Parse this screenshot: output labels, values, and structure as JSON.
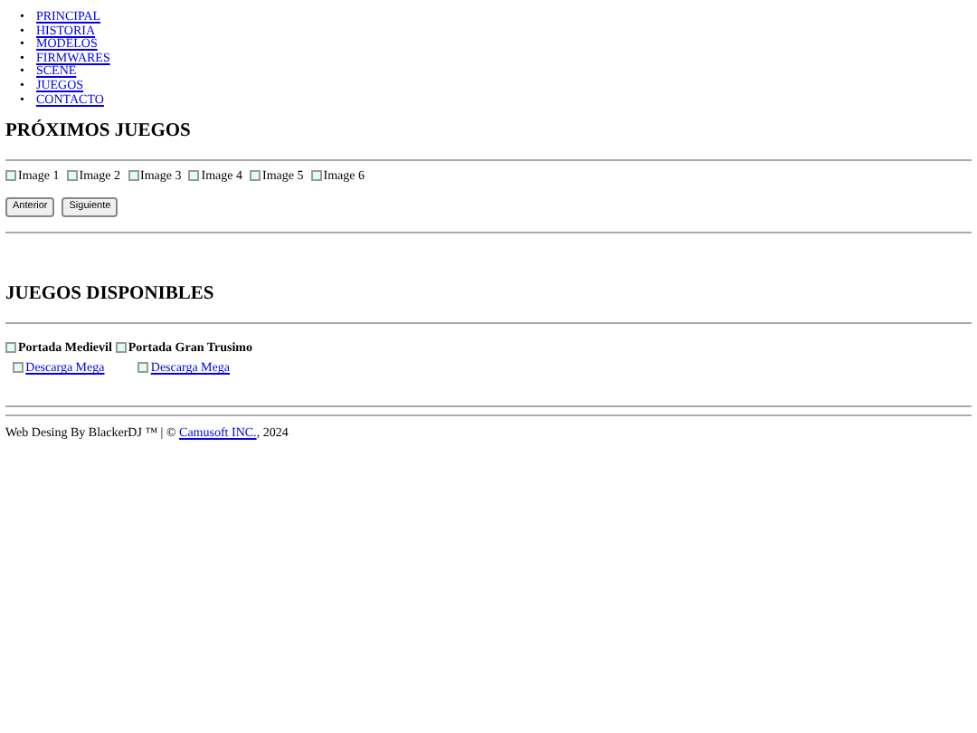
{
  "nav": [
    {
      "marker": "•",
      "label": "PRINCIPAL"
    },
    {
      "marker": "•",
      "label": "HISTORIA"
    },
    {
      "marker": "•",
      "label": "MODELOS"
    },
    {
      "marker": "•",
      "label": "FIRMWARES"
    },
    {
      "marker": "•",
      "label": "SCENE"
    },
    {
      "marker": "•",
      "label": "JUEGOS"
    },
    {
      "marker": "•",
      "label": "CONTACTO"
    }
  ],
  "upcoming": {
    "title": "PRÓXIMOS JUEGOS",
    "images": [
      "Image 1",
      "Image 2",
      "Image 3",
      "Image 4",
      "Image 5",
      "Image 6"
    ],
    "buttons": [
      "Anterior",
      "Siguiente"
    ]
  },
  "available": {
    "title": "JUEGOS DISPONIBLES",
    "games": [
      {
        "cover": "Portada Medievil",
        "download": "Descarga Mega"
      },
      {
        "cover": "Portada Gran Trusimo",
        "download": "Descarga Mega"
      }
    ]
  },
  "footer": {
    "before": "Web Desing By BlackerDJ ™ | ©",
    "link": "Camusoft INC.",
    "after": ", 2024"
  }
}
